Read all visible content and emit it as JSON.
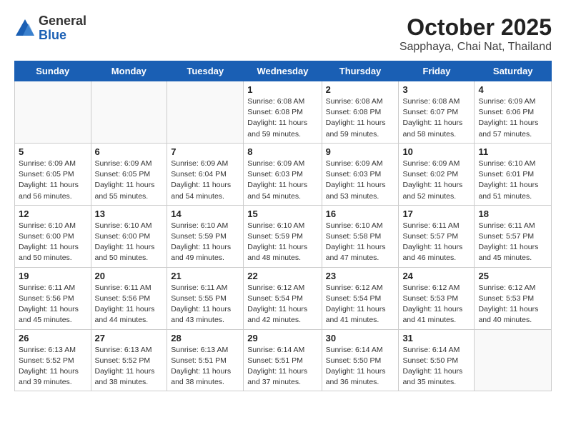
{
  "header": {
    "logo_general": "General",
    "logo_blue": "Blue",
    "month": "October 2025",
    "location": "Sapphaya, Chai Nat, Thailand"
  },
  "weekdays": [
    "Sunday",
    "Monday",
    "Tuesday",
    "Wednesday",
    "Thursday",
    "Friday",
    "Saturday"
  ],
  "weeks": [
    [
      {
        "day": "",
        "info": ""
      },
      {
        "day": "",
        "info": ""
      },
      {
        "day": "",
        "info": ""
      },
      {
        "day": "1",
        "info": "Sunrise: 6:08 AM\nSunset: 6:08 PM\nDaylight: 11 hours\nand 59 minutes."
      },
      {
        "day": "2",
        "info": "Sunrise: 6:08 AM\nSunset: 6:08 PM\nDaylight: 11 hours\nand 59 minutes."
      },
      {
        "day": "3",
        "info": "Sunrise: 6:08 AM\nSunset: 6:07 PM\nDaylight: 11 hours\nand 58 minutes."
      },
      {
        "day": "4",
        "info": "Sunrise: 6:09 AM\nSunset: 6:06 PM\nDaylight: 11 hours\nand 57 minutes."
      }
    ],
    [
      {
        "day": "5",
        "info": "Sunrise: 6:09 AM\nSunset: 6:05 PM\nDaylight: 11 hours\nand 56 minutes."
      },
      {
        "day": "6",
        "info": "Sunrise: 6:09 AM\nSunset: 6:05 PM\nDaylight: 11 hours\nand 55 minutes."
      },
      {
        "day": "7",
        "info": "Sunrise: 6:09 AM\nSunset: 6:04 PM\nDaylight: 11 hours\nand 54 minutes."
      },
      {
        "day": "8",
        "info": "Sunrise: 6:09 AM\nSunset: 6:03 PM\nDaylight: 11 hours\nand 54 minutes."
      },
      {
        "day": "9",
        "info": "Sunrise: 6:09 AM\nSunset: 6:03 PM\nDaylight: 11 hours\nand 53 minutes."
      },
      {
        "day": "10",
        "info": "Sunrise: 6:09 AM\nSunset: 6:02 PM\nDaylight: 11 hours\nand 52 minutes."
      },
      {
        "day": "11",
        "info": "Sunrise: 6:10 AM\nSunset: 6:01 PM\nDaylight: 11 hours\nand 51 minutes."
      }
    ],
    [
      {
        "day": "12",
        "info": "Sunrise: 6:10 AM\nSunset: 6:00 PM\nDaylight: 11 hours\nand 50 minutes."
      },
      {
        "day": "13",
        "info": "Sunrise: 6:10 AM\nSunset: 6:00 PM\nDaylight: 11 hours\nand 50 minutes."
      },
      {
        "day": "14",
        "info": "Sunrise: 6:10 AM\nSunset: 5:59 PM\nDaylight: 11 hours\nand 49 minutes."
      },
      {
        "day": "15",
        "info": "Sunrise: 6:10 AM\nSunset: 5:59 PM\nDaylight: 11 hours\nand 48 minutes."
      },
      {
        "day": "16",
        "info": "Sunrise: 6:10 AM\nSunset: 5:58 PM\nDaylight: 11 hours\nand 47 minutes."
      },
      {
        "day": "17",
        "info": "Sunrise: 6:11 AM\nSunset: 5:57 PM\nDaylight: 11 hours\nand 46 minutes."
      },
      {
        "day": "18",
        "info": "Sunrise: 6:11 AM\nSunset: 5:57 PM\nDaylight: 11 hours\nand 45 minutes."
      }
    ],
    [
      {
        "day": "19",
        "info": "Sunrise: 6:11 AM\nSunset: 5:56 PM\nDaylight: 11 hours\nand 45 minutes."
      },
      {
        "day": "20",
        "info": "Sunrise: 6:11 AM\nSunset: 5:56 PM\nDaylight: 11 hours\nand 44 minutes."
      },
      {
        "day": "21",
        "info": "Sunrise: 6:11 AM\nSunset: 5:55 PM\nDaylight: 11 hours\nand 43 minutes."
      },
      {
        "day": "22",
        "info": "Sunrise: 6:12 AM\nSunset: 5:54 PM\nDaylight: 11 hours\nand 42 minutes."
      },
      {
        "day": "23",
        "info": "Sunrise: 6:12 AM\nSunset: 5:54 PM\nDaylight: 11 hours\nand 41 minutes."
      },
      {
        "day": "24",
        "info": "Sunrise: 6:12 AM\nSunset: 5:53 PM\nDaylight: 11 hours\nand 41 minutes."
      },
      {
        "day": "25",
        "info": "Sunrise: 6:12 AM\nSunset: 5:53 PM\nDaylight: 11 hours\nand 40 minutes."
      }
    ],
    [
      {
        "day": "26",
        "info": "Sunrise: 6:13 AM\nSunset: 5:52 PM\nDaylight: 11 hours\nand 39 minutes."
      },
      {
        "day": "27",
        "info": "Sunrise: 6:13 AM\nSunset: 5:52 PM\nDaylight: 11 hours\nand 38 minutes."
      },
      {
        "day": "28",
        "info": "Sunrise: 6:13 AM\nSunset: 5:51 PM\nDaylight: 11 hours\nand 38 minutes."
      },
      {
        "day": "29",
        "info": "Sunrise: 6:14 AM\nSunset: 5:51 PM\nDaylight: 11 hours\nand 37 minutes."
      },
      {
        "day": "30",
        "info": "Sunrise: 6:14 AM\nSunset: 5:50 PM\nDaylight: 11 hours\nand 36 minutes."
      },
      {
        "day": "31",
        "info": "Sunrise: 6:14 AM\nSunset: 5:50 PM\nDaylight: 11 hours\nand 35 minutes."
      },
      {
        "day": "",
        "info": ""
      }
    ]
  ]
}
